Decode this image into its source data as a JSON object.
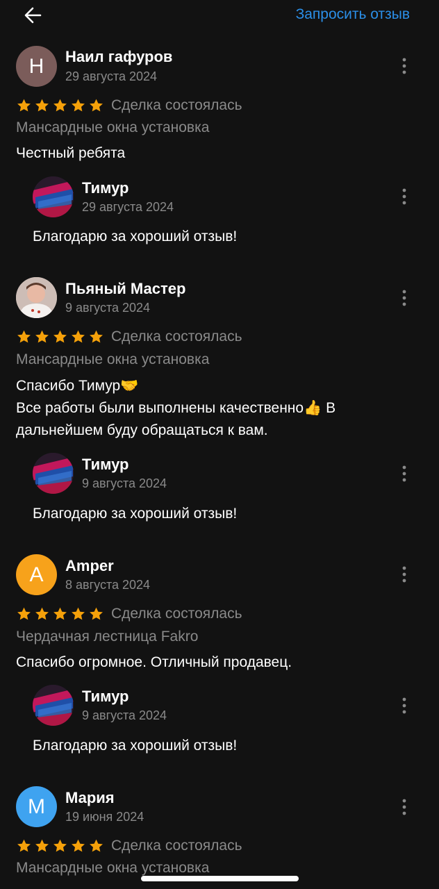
{
  "header": {
    "back_icon": "arrow-left-icon",
    "request_review": "Запросить отзыв"
  },
  "colors": {
    "background": "#121212",
    "accent_link": "#2b8fe8",
    "star": "#f5a10a",
    "muted_text": "#8a8a8a"
  },
  "reviews": [
    {
      "avatar_letter": "Н",
      "avatar_color": "#7b5c5a",
      "name": "Наил гафуров",
      "date": "29 августа 2024",
      "rating": 5,
      "deal_status": "Сделка состоялась",
      "category": "Мансардные окна установка",
      "text": [
        "Честный ребята"
      ],
      "reply": {
        "name": "Тимур",
        "date": "29 августа 2024",
        "text": "Благодарю за хороший отзыв!"
      }
    },
    {
      "avatar_letter": "",
      "avatar_color": "#d9c9c4",
      "name": "Пьяный Мастер",
      "date": "9 августа 2024",
      "rating": 5,
      "deal_status": "Сделка состоялась",
      "category": "Мансардные окна установка",
      "text": [
        "Спасибо Тимур🤝",
        "Все работы были выполнены качественно👍 В",
        "дальнейшем буду обращаться к вам."
      ],
      "reply": {
        "name": "Тимур",
        "date": "9 августа 2024",
        "text": "Благодарю за хороший отзыв!"
      }
    },
    {
      "avatar_letter": "A",
      "avatar_color": "#f7a21b",
      "name": "Amper",
      "date": "8 августа 2024",
      "rating": 5,
      "deal_status": "Сделка состоялась",
      "category": "Чердачная лестница Fakro",
      "text": [
        "Спасибо огромное. Отличный продавец."
      ],
      "reply": {
        "name": "Тимур",
        "date": "9 августа 2024",
        "text": "Благодарю за хороший отзыв!"
      }
    },
    {
      "avatar_letter": "М",
      "avatar_color": "#3fa3f0",
      "name": "Мария",
      "date": "19 июня 2024",
      "rating": 5,
      "deal_status": "Сделка состоялась",
      "category": "Мансардные окна установка"
    }
  ]
}
